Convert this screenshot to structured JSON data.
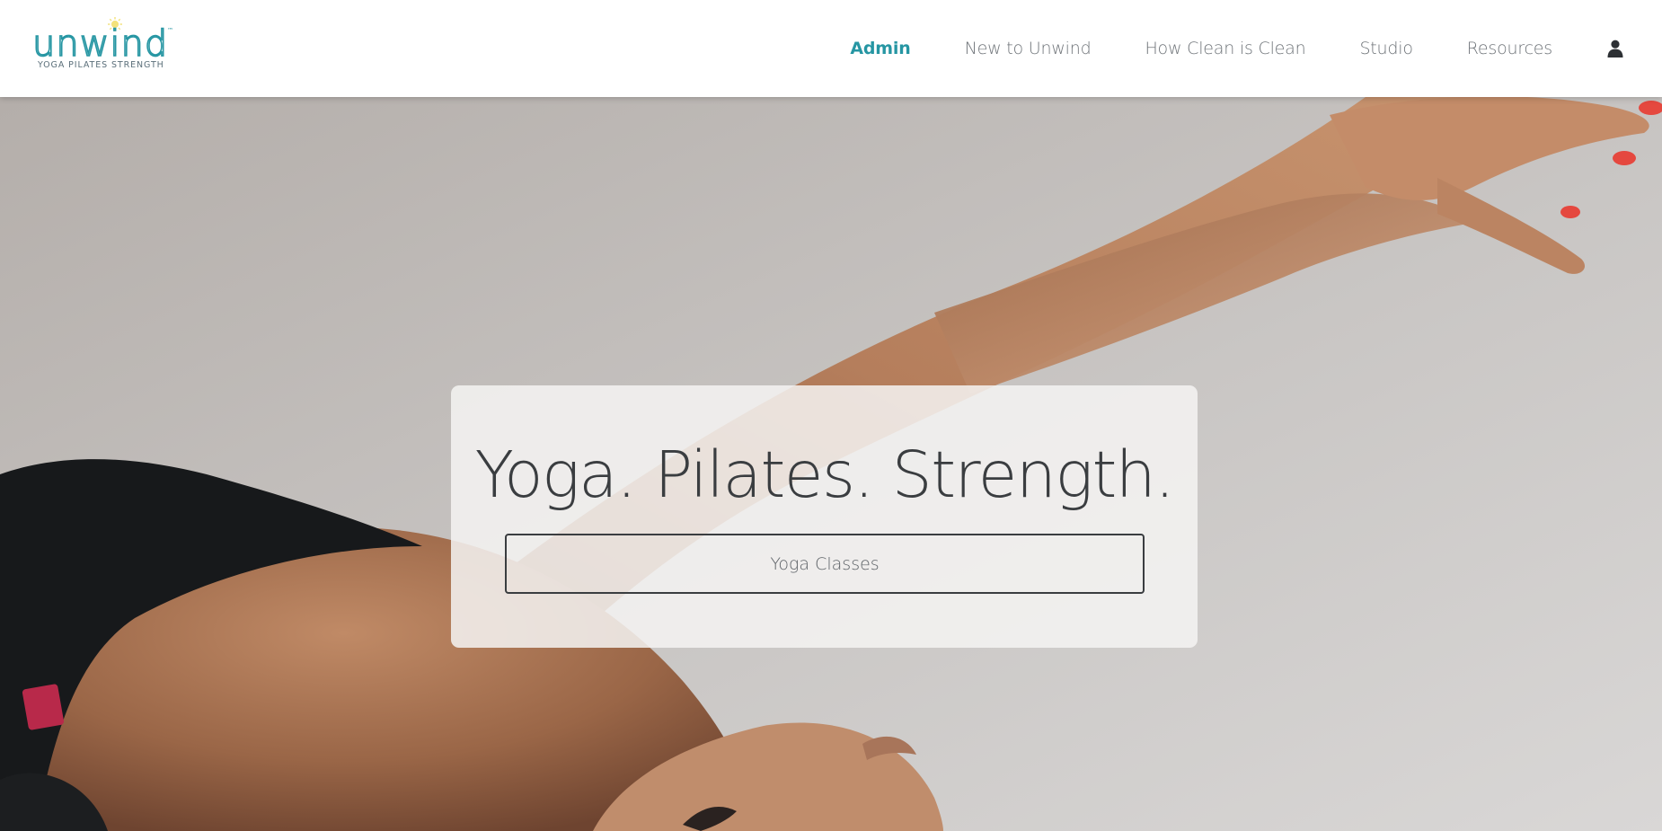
{
  "brand": {
    "name": "unwind",
    "tagline": "YOGA  PILATES  STRENGTH",
    "trademark": "™",
    "accent_color": "#2696a3",
    "sun_color": "#f3e27a"
  },
  "nav": {
    "items": [
      {
        "label": "Admin",
        "active": true
      },
      {
        "label": "New to Unwind",
        "active": false
      },
      {
        "label": "How Clean is Clean",
        "active": false
      },
      {
        "label": "Studio",
        "active": false
      },
      {
        "label": "Resources",
        "active": false
      }
    ],
    "account_icon": "user-icon"
  },
  "hero": {
    "title": "Yoga. Pilates. Strength.",
    "button_label": "Yoga Classes",
    "background_image": "woman-stretching-arms-photo",
    "card_color": "#f4f3f2",
    "text_color": "#3a3d40"
  }
}
